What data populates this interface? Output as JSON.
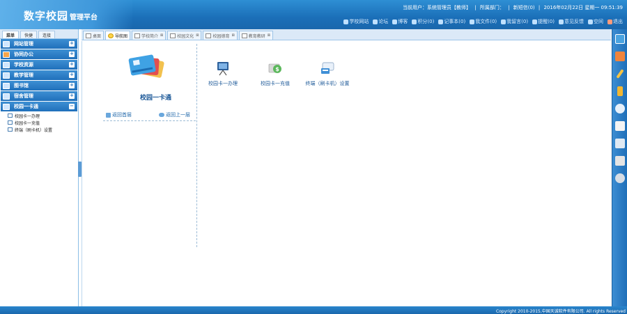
{
  "header": {
    "brand_main": "数字校园",
    "brand_sub": "管理平台",
    "user_label": "当前用户：系统管理员【教师】",
    "dept_label": "所属部门：",
    "message_label": "新短信(0)",
    "date_label": "2016年02月22日 星期一 09:51:39"
  },
  "toolbar": {
    "links": [
      {
        "label": "学校网站",
        "icon": "globe-icon"
      },
      {
        "label": "论坛",
        "icon": "forum-icon"
      },
      {
        "label": "博客",
        "icon": "blog-icon"
      },
      {
        "label": "积分(0)",
        "icon": "points-icon"
      },
      {
        "label": "记事本(0)",
        "icon": "notepad-icon"
      },
      {
        "label": "我文件(0)",
        "icon": "file-icon"
      },
      {
        "label": "我留言(0)",
        "icon": "message-icon"
      },
      {
        "label": "提醒(0)",
        "icon": "bell-icon"
      },
      {
        "label": "意见反馈",
        "icon": "feedback-icon"
      },
      {
        "label": "空间",
        "icon": "space-icon"
      },
      {
        "label": "退出",
        "icon": "logout-icon"
      }
    ]
  },
  "sidebar": {
    "tabs": [
      "菜单",
      "快捷",
      "连接"
    ],
    "menu": [
      "网站管理",
      "协同办公",
      "学校资源",
      "教学管理",
      "图书馆",
      "宿舍管理",
      "校园一卡通"
    ],
    "sub_items": [
      "校园卡一办理",
      "校园卡一充值",
      "终端（刷卡机）设置"
    ]
  },
  "tabs": [
    {
      "label": "桌面",
      "icon": "desktop-icon"
    },
    {
      "label": "导航图",
      "icon": "navigation-icon"
    },
    {
      "label": "学校简介",
      "icon": "document-icon"
    },
    {
      "label": "校园文化",
      "icon": "document-icon"
    },
    {
      "label": "校园德育",
      "icon": "document-icon"
    },
    {
      "label": "教育教研",
      "icon": "document-icon"
    }
  ],
  "main": {
    "card_title": "校园一卡通",
    "home_link": "返回首层",
    "up_link": "返回上一层",
    "modules": [
      "校园卡一办理",
      "校园卡一充值",
      "终端（刷卡机）设置"
    ]
  },
  "footer": {
    "copyright": "Copyright 2010-2015,中国天诚软件有限公司. All rights Reserved"
  }
}
